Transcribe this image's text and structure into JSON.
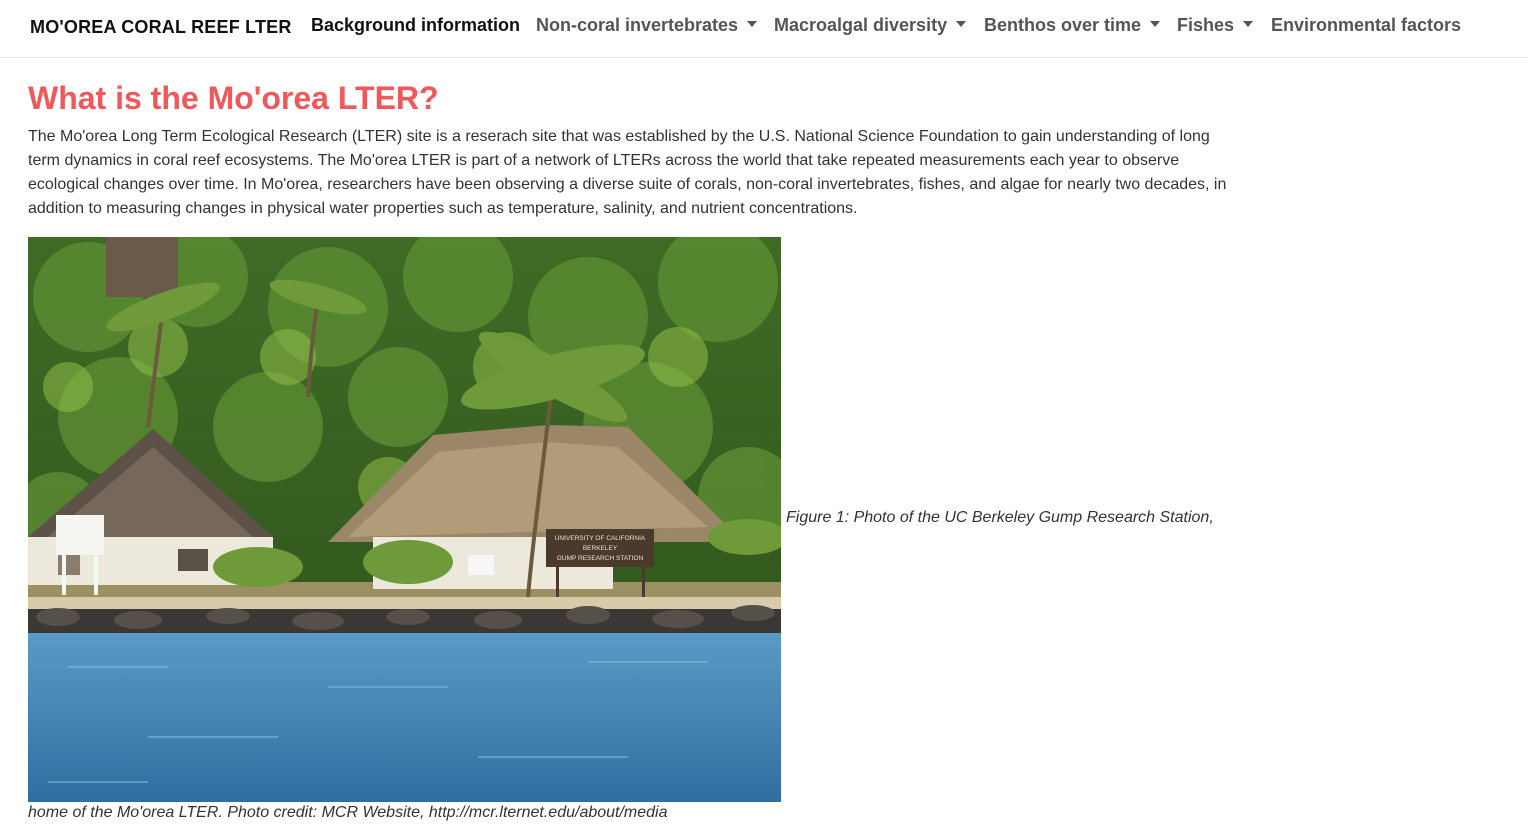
{
  "navbar": {
    "brand": "MO'OREA CORAL REEF LTER",
    "items": [
      {
        "label": "Background information",
        "active": true,
        "dropdown": false
      },
      {
        "label": "Non-coral invertebrates",
        "active": false,
        "dropdown": true
      },
      {
        "label": "Macroalgal diversity",
        "active": false,
        "dropdown": true
      },
      {
        "label": "Benthos over time",
        "active": false,
        "dropdown": true
      },
      {
        "label": "Fishes",
        "active": false,
        "dropdown": true
      },
      {
        "label": "Environmental factors",
        "active": false,
        "dropdown": false
      }
    ]
  },
  "main": {
    "title": "What is the Mo'orea LTER?",
    "intro": "The Mo'orea Long Term Ecological Research (LTER) site is a reserach site that was established by the U.S. National Science Foundation to gain understanding of long term dynamics in coral reef ecosystems. The Mo'orea LTER is part of a network of LTERs across the world that take repeated measurements each year to observe ecological changes over time. In Mo'orea, researchers have been observing a diverse suite of corals, non-coral invertebrates, fishes, and algae for nearly two decades, in addition to measuring changes in physical water properties such as temperature, salinity, and nutrient concentrations.",
    "figure": {
      "caption_line1": "Figure 1: Photo of the UC Berkeley Gump Research Station,",
      "caption_line2": "home of the Mo'orea LTER. Photo credit: MCR Website, http://mcr.lternet.edu/about/media",
      "sign_line1": "UNIVERSITY OF CALIFORNIA",
      "sign_line2": "BERKELEY",
      "sign_line3": "GUMP RESEARCH STATION"
    }
  },
  "colors": {
    "title": "#f0585b",
    "nav_text": "#555555",
    "nav_active": "#111111",
    "water": "#3f86b8"
  }
}
